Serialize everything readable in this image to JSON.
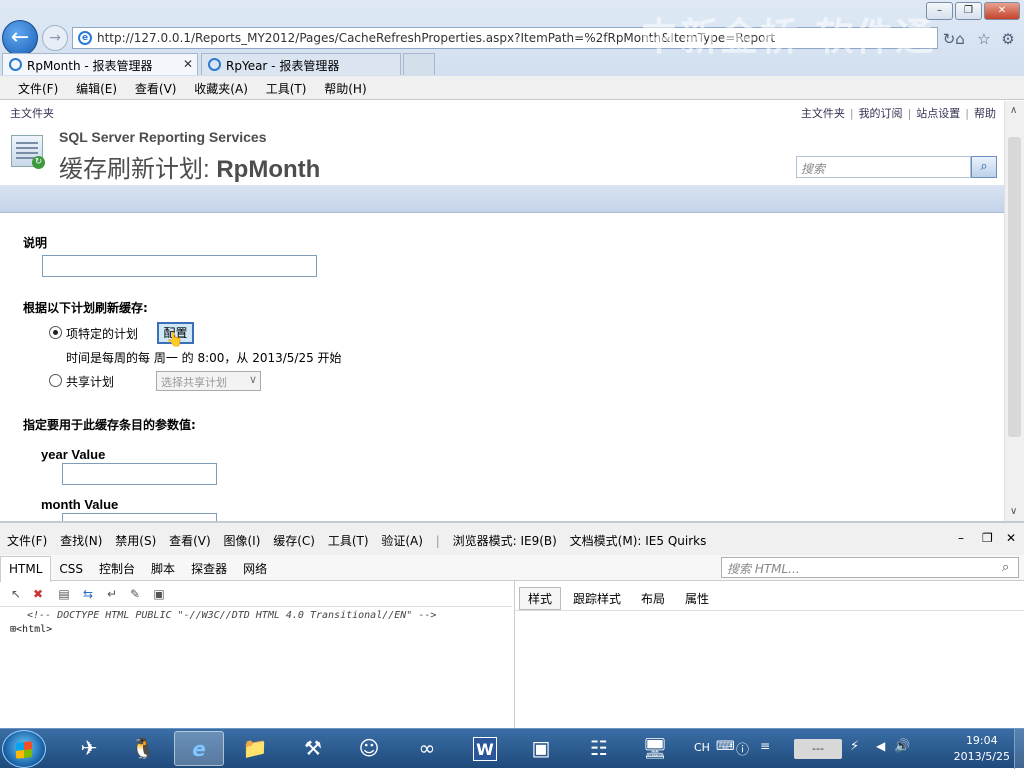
{
  "browser": {
    "url": "http://127.0.0.1/Reports_MY2012/Pages/CacheRefreshProperties.aspx?ItemPath=%2fRpMonth&ItemType=Report",
    "watermark": "中新金桥  软件通",
    "tabs": [
      {
        "label": "RpMonth - 报表管理器"
      },
      {
        "label": "RpYear - 报表管理器"
      }
    ],
    "menu": [
      "文件(F)",
      "编辑(E)",
      "查看(V)",
      "收藏夹(A)",
      "工具(T)",
      "帮助(H)"
    ]
  },
  "page": {
    "breadcrumb": "主文件夹",
    "top_links": [
      "主文件夹",
      "我的订阅",
      "站点设置",
      "帮助"
    ],
    "product": "SQL Server Reporting Services",
    "title_prefix": "缓存刷新计划: ",
    "title_name": "RpMonth",
    "search_placeholder": "搜索",
    "description_label": "说明",
    "description_value": "",
    "refresh_label": "根据以下计划刷新缓存:",
    "option_specific": "项特定的计划",
    "configure_button": "配置",
    "schedule_text": "时间是每周的每 周一 的 8:00，从 2013/5/25 开始",
    "option_shared": "共享计划",
    "shared_select": "选择共享计划",
    "params_label": "指定要用于此缓存条目的参数值:",
    "param1_label": "year Value",
    "param1_value": "",
    "param2_label": "month Value"
  },
  "devtools": {
    "menu": [
      "文件(F)",
      "查找(N)",
      "禁用(S)",
      "查看(V)",
      "图像(I)",
      "缓存(C)",
      "工具(T)",
      "验证(A)",
      "浏览器模式: IE9(B)",
      "文档模式(M): IE5 Quirks"
    ],
    "tabs": [
      "HTML",
      "CSS",
      "控制台",
      "脚本",
      "探查器",
      "网络"
    ],
    "search_placeholder": "搜索 HTML...",
    "source_line1": "<!-- DOCTYPE HTML PUBLIC \"-//W3C//DTD HTML 4.0 Transitional//EN\" -->",
    "source_line2": "<html>",
    "right_tabs": [
      "样式",
      "跟踪样式",
      "布局",
      "属性"
    ]
  },
  "taskbar": {
    "lang": "CH",
    "time": "19:04",
    "date": "2013/5/25"
  },
  "colors": {
    "accent": "#1a5fb4",
    "page_bar": "#c3d3e8",
    "taskbar": "#1f4a7c"
  }
}
